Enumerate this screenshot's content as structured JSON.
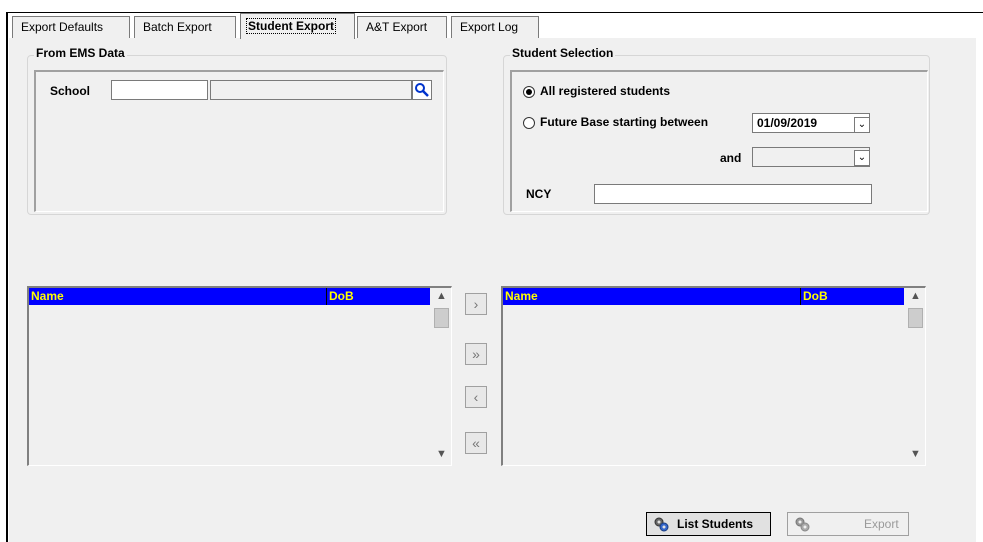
{
  "tabs": [
    {
      "label": "Export Defaults",
      "active": false
    },
    {
      "label": "Batch Export",
      "active": false
    },
    {
      "label": "Student Export",
      "active": true
    },
    {
      "label": "A&T Export",
      "active": false
    },
    {
      "label": "Export Log",
      "active": false
    }
  ],
  "from_ems": {
    "legend": "From EMS Data",
    "school_label": "School",
    "school_code": "",
    "school_name": "",
    "search_icon": "magnifier-icon"
  },
  "student_selection": {
    "legend": "Student Selection",
    "option_all": "All registered students",
    "option_all_selected": true,
    "option_future": "Future Base starting between",
    "option_future_selected": false,
    "start_date": "01/09/2019",
    "and_label": "and",
    "end_date": "",
    "ncy_label": "NCY",
    "ncy_value": ""
  },
  "left_list": {
    "columns": [
      "Name",
      "DoB"
    ],
    "rows": []
  },
  "right_list": {
    "columns": [
      "Name",
      "DoB"
    ],
    "rows": []
  },
  "move_buttons": [
    "move-one-right",
    "move-all-right",
    "move-one-left",
    "move-all-left"
  ],
  "actions": {
    "list_students": "List Students",
    "export": "Export"
  },
  "colors": {
    "list_header_bg": "#0000ff",
    "list_header_fg": "#ffff00"
  }
}
